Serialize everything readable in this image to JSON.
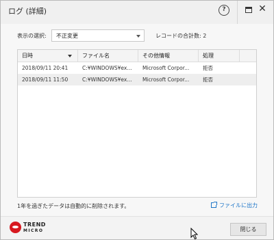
{
  "window": {
    "title": "ログ (詳細)",
    "help_label": "?",
    "close_label": "✕"
  },
  "filter": {
    "label": "表示の選択:",
    "selected": "不正変更",
    "record_count_label": "レコードの合計数: 2"
  },
  "table": {
    "columns": [
      "日時",
      "ファイル名",
      "その他情報",
      "処理"
    ],
    "rows": [
      [
        "2018/09/11 20:41",
        "C:¥WINDOWS¥ex...",
        "Microsoft Corpor...",
        "拒否"
      ],
      [
        "2018/09/11 11:50",
        "C:¥WINDOWS¥ex...",
        "Microsoft Corpor...",
        "拒否"
      ]
    ],
    "row_colors": [
      "#ffffff",
      "#eeeeee"
    ]
  },
  "footer": {
    "note": "1年を過ぎたデータは自動的に削除されます。",
    "export_label": "ファイルに出力",
    "close_button": "閉じる"
  },
  "brand": {
    "name_line1": "TREND",
    "name_line2": "MICRO",
    "accent": "#d71920"
  },
  "colors": {
    "link": "#1a73c7"
  }
}
